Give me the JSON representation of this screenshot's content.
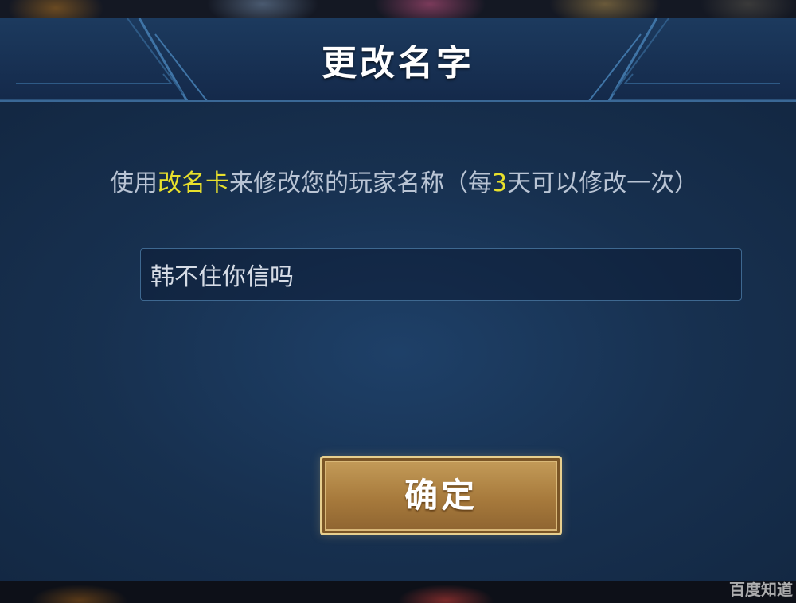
{
  "dialog": {
    "title": "更改名字",
    "description": {
      "prefix": "使用",
      "card_name": "改名卡",
      "middle": "来修改您的玩家名称（每",
      "days": "3",
      "suffix": "天可以修改一次）"
    },
    "name_input": {
      "value": "韩不住你信吗",
      "placeholder": ""
    },
    "confirm_label": "确定"
  },
  "watermark": "百度知道",
  "colors": {
    "highlight": "#e8e02c",
    "panel": "#17304f",
    "button_gold": "#a77a3c"
  }
}
